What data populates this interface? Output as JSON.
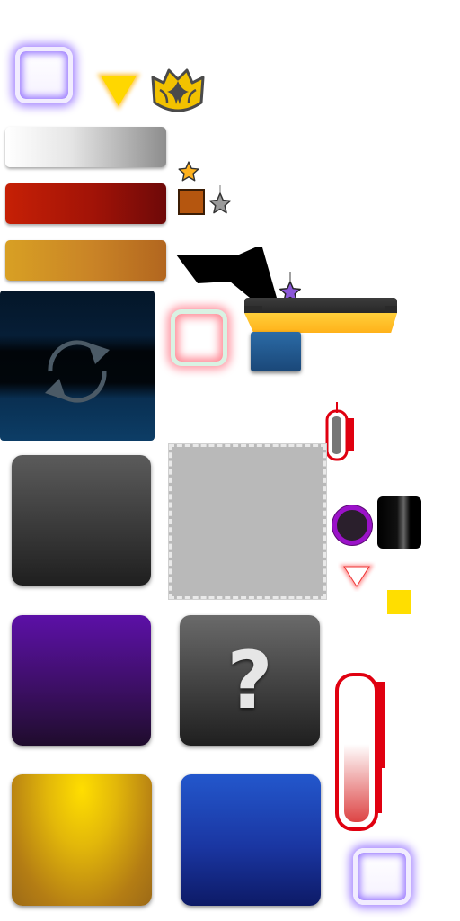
{
  "sprite_sheet": {
    "tiles": {
      "help_glyph": "?"
    },
    "icons": [
      "glow-frame-purple",
      "yellow-arrow-down",
      "crest-badge",
      "gold-star",
      "gray-star",
      "purple-star",
      "refresh-icon",
      "red-triangle-down"
    ],
    "colors": {
      "gold": "#ffde00",
      "purple": "#5c10a7",
      "blue": "#1a36a2",
      "red": "#c62005"
    }
  }
}
